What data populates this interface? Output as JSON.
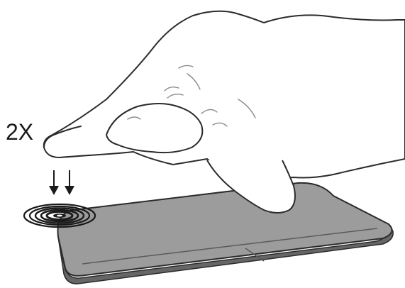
{
  "gesture": {
    "tap_count_label": "2X"
  },
  "colors": {
    "touchpad_fill": "#9c9c9c",
    "touchpad_edge": "#666666",
    "outline": "#2b2b2b",
    "hand_fill": "#ffffff",
    "skin_line": "#8a8a8a",
    "ripple": "#1a1a1a"
  },
  "icons": {
    "tap_indicator": "concentric-ripple-icon",
    "direction": "down-arrow-icon"
  }
}
